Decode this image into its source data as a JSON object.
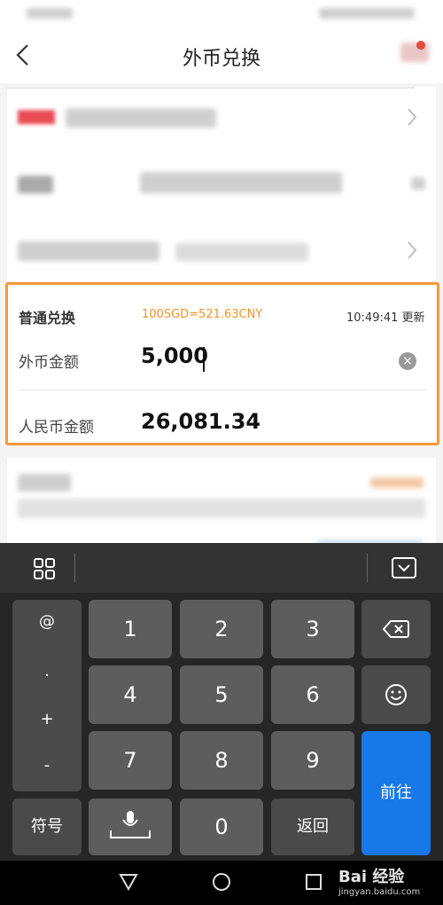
{
  "header": {
    "title": "外币兑换",
    "back_icon": "chevron-left-icon"
  },
  "exchange": {
    "label": "普通兑换",
    "rate": "100SGD=521.63CNY",
    "time": "10:49:41 更新",
    "foreign_label": "外币金额",
    "foreign_value": "5,000",
    "rmb_label": "人民币金额",
    "rmb_value": "26,081.34",
    "accent_color": "#f39a3b"
  },
  "keyboard": {
    "side_keys": [
      "@",
      ".",
      "+",
      "-"
    ],
    "digits": [
      "1",
      "2",
      "3",
      "4",
      "5",
      "6",
      "7",
      "8",
      "9",
      "0"
    ],
    "symbol_label": "符号",
    "return_label": "返回",
    "go_label": "前往",
    "go_color": "#1778e8"
  },
  "watermark": {
    "brand": "Bai 经验",
    "url": "jingyan.baidu.com"
  }
}
